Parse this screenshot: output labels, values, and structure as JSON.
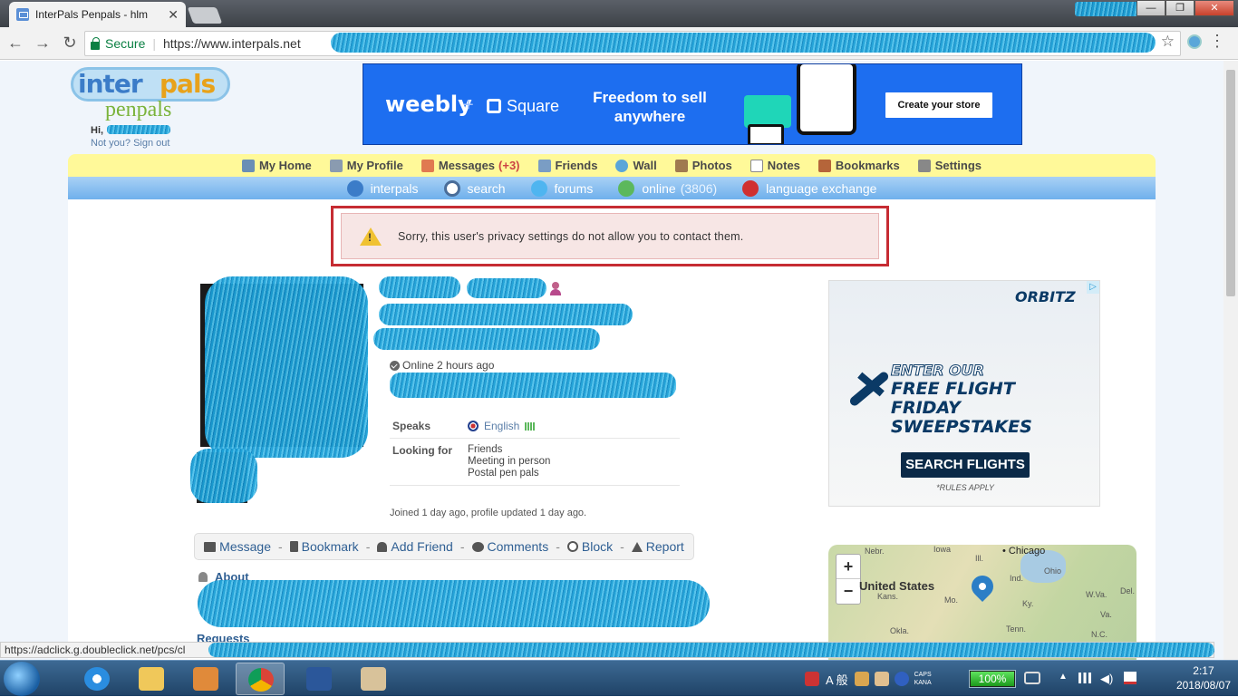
{
  "browser": {
    "tab_title": "InterPals Penpals - hlm",
    "tab_close": "✕",
    "nav_back": "←",
    "nav_forward": "→",
    "nav_reload": "↻",
    "secure_label": "Secure",
    "url": "https://www.interpals.net",
    "star": "☆",
    "menu": "⋮",
    "win_min": "—",
    "win_max": "❐",
    "win_close": "✕"
  },
  "site": {
    "logo_inter": "inter",
    "logo_pals": "pals",
    "logo_penpals": "penpals",
    "greeting": "Hi,",
    "signout": "Not you? Sign out"
  },
  "banner": {
    "brand": "weebly",
    "plus": "+",
    "partner": "Square",
    "headline": "Freedom to sell anywhere",
    "cta": "Create your store"
  },
  "nav_primary": [
    {
      "label": "My Home",
      "icon": "home-icon",
      "color": "#6a8fb5"
    },
    {
      "label": "My Profile",
      "icon": "profile-icon",
      "color": "#8a9bb0"
    },
    {
      "label": "Messages",
      "count": "(+3)",
      "icon": "envelope-icon",
      "color": "#e07a50"
    },
    {
      "label": "Friends",
      "icon": "friends-icon",
      "color": "#7a9dc4"
    },
    {
      "label": "Wall",
      "icon": "wall-icon",
      "color": "#5aa6d9"
    },
    {
      "label": "Photos",
      "icon": "photos-icon",
      "color": "#a07a50"
    },
    {
      "label": "Notes",
      "icon": "notes-icon",
      "color": "#dddddd"
    },
    {
      "label": "Bookmarks",
      "icon": "bookmarks-icon",
      "color": "#b5653a"
    },
    {
      "label": "Settings",
      "icon": "settings-icon",
      "color": "#888888"
    }
  ],
  "nav_secondary": [
    {
      "label": "interpals",
      "icon": "globe-icon",
      "color": "#3b7cc8"
    },
    {
      "label": "search",
      "icon": "search-icon",
      "color": "#f0f0f0"
    },
    {
      "label": "forums",
      "icon": "forums-icon",
      "color": "#4fb5f0"
    },
    {
      "label": "online",
      "count": "(3806)",
      "icon": "online-icon",
      "color": "#5cb85c"
    },
    {
      "label": "language exchange",
      "icon": "flags-icon",
      "color": "#d03030"
    }
  ],
  "error_message": "Sorry, this user's privacy settings do not allow you to contact them.",
  "profile": {
    "online_status": "Online 2 hours ago",
    "speaks_label": "Speaks",
    "speaks_language": "English",
    "looking_for_label": "Looking for",
    "looking_for": [
      "Friends",
      "Meeting in person",
      "Postal pen pals"
    ],
    "joined": "Joined 1 day ago, profile updated 1 day ago."
  },
  "actions": [
    {
      "label": "Message",
      "icon": "envelope-icon"
    },
    {
      "label": "Bookmark",
      "icon": "bookmark-icon"
    },
    {
      "label": "Add Friend",
      "icon": "add-friend-icon"
    },
    {
      "label": "Comments",
      "icon": "comment-icon"
    },
    {
      "label": "Block",
      "icon": "block-icon"
    },
    {
      "label": "Report",
      "icon": "warning-icon"
    }
  ],
  "action_separator": "-",
  "sections": {
    "about": "About",
    "requests": "Requests"
  },
  "orbitz_ad": {
    "logo": "ORBITZ",
    "adchoice": "▷",
    "line1": "ENTER OUR",
    "line2": "FREE FLIGHT",
    "line3": "FRIDAY SWEEPSTAKES",
    "button": "SEARCH FLIGHTS",
    "rules": "*RULES APPLY"
  },
  "map": {
    "zoom_in": "+",
    "zoom_out": "−",
    "country": "United States",
    "city": "• Chicago",
    "labels": [
      "Nebr.",
      "Iowa",
      "Ill.",
      "Ind.",
      "Ohio",
      "Kans.",
      "Mo.",
      "Ky.",
      "W.Va.",
      "Okla.",
      "Tenn.",
      "N.C.",
      "Va.",
      "Del."
    ]
  },
  "status_url": "https://adclick.g.doubleclick.net/pcs/cl",
  "taskbar": {
    "battery": "100%",
    "time": "2:17",
    "date": "2018/08/07",
    "ime": "A 般",
    "caps": "CAPS",
    "kana": "KANA"
  }
}
